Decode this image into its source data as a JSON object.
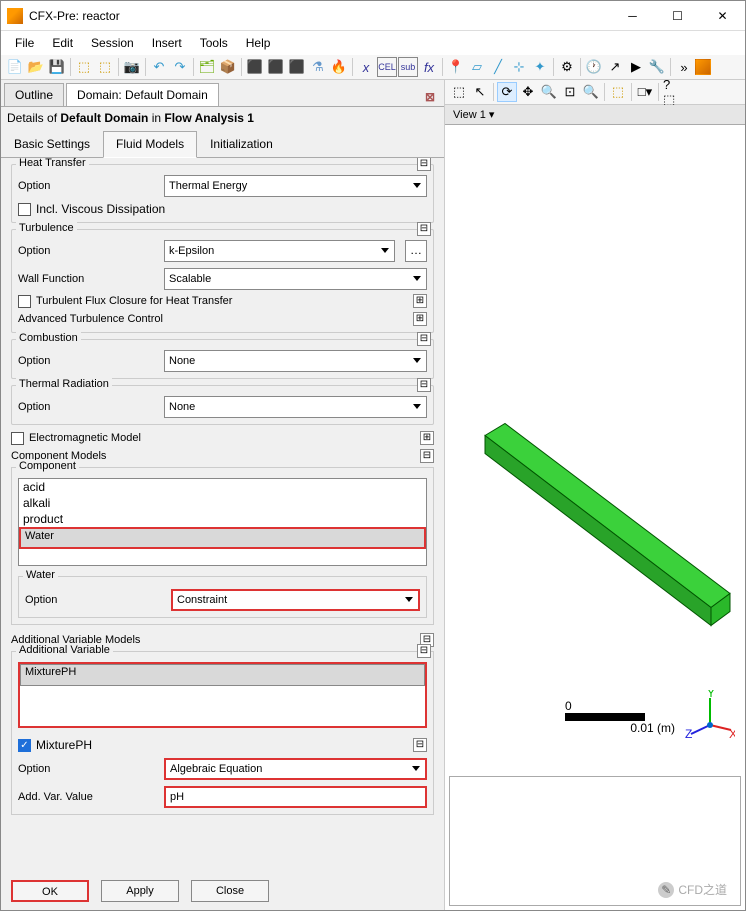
{
  "window": {
    "title": "CFX-Pre:  reactor"
  },
  "menu": {
    "file": "File",
    "edit": "Edit",
    "session": "Session",
    "insert": "Insert",
    "tools": "Tools",
    "help": "Help"
  },
  "tabs": {
    "outline": "Outline",
    "domain": "Domain: Default Domain"
  },
  "details": {
    "prefix": "Details of ",
    "name": "Default Domain",
    "mid": " in ",
    "analysis": "Flow Analysis 1"
  },
  "subtabs": {
    "basic": "Basic Settings",
    "fluid": "Fluid Models",
    "init": "Initialization"
  },
  "heat": {
    "title": "Heat Transfer",
    "option_lbl": "Option",
    "option_val": "Thermal Energy",
    "incl": "Incl. Viscous Dissipation"
  },
  "turb": {
    "title": "Turbulence",
    "option_lbl": "Option",
    "option_val": "k-Epsilon",
    "wall_lbl": "Wall Function",
    "wall_val": "Scalable",
    "flux": "Turbulent Flux Closure for Heat Transfer",
    "adv": "Advanced Turbulence Control"
  },
  "comb": {
    "title": "Combustion",
    "option_lbl": "Option",
    "option_val": "None"
  },
  "thrad": {
    "title": "Thermal Radiation",
    "option_lbl": "Option",
    "option_val": "None"
  },
  "em": {
    "label": "Electromagnetic Model"
  },
  "compmodels": {
    "title": "Component Models",
    "component_title": "Component",
    "items": [
      "acid",
      "alkali",
      "product",
      "Water"
    ],
    "selected": "Water",
    "sub_title": "Water",
    "option_lbl": "Option",
    "option_val": "Constraint"
  },
  "addvar": {
    "title": "Additional Variable Models",
    "var_title": "Additional Variable",
    "item": "MixturePH",
    "chk": "MixturePH",
    "option_lbl": "Option",
    "option_val": "Algebraic Equation",
    "val_lbl": "Add. Var. Value",
    "val_val": "pH"
  },
  "buttons": {
    "ok": "OK",
    "apply": "Apply",
    "close": "Close"
  },
  "view": {
    "tab": "View 1  ▾",
    "scale_zero": "0",
    "scale_val": "0.01  (m)"
  },
  "watermark": "CFD之道"
}
